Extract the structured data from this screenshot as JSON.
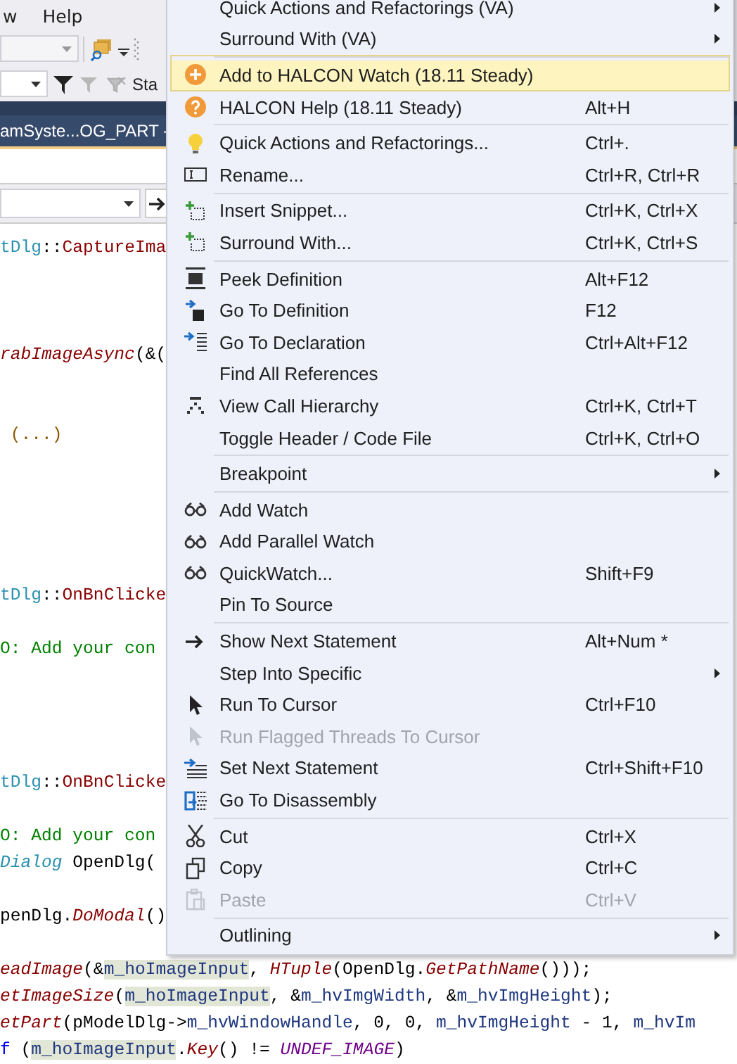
{
  "menu_bar": {
    "items": [
      "w",
      "Help"
    ]
  },
  "toolbar": {
    "overflow_label": "Sta"
  },
  "document_tab": {
    "title": "amSyste...OG_PART -"
  },
  "code_lines": [
    {
      "kind": "code",
      "segments": [
        {
          "t": "tDlg",
          "kind": "class"
        },
        {
          "t": "::",
          "kind": "plain"
        },
        {
          "t": "CaptureIma",
          "kind": "method"
        }
      ]
    },
    {
      "kind": "blank"
    },
    {
      "kind": "blank"
    },
    {
      "kind": "blank"
    },
    {
      "kind": "code",
      "segments": [
        {
          "t": "rabImageAsync",
          "kind": "func"
        },
        {
          "t": "(&(",
          "kind": "plain"
        }
      ]
    },
    {
      "kind": "blank"
    },
    {
      "kind": "blank"
    },
    {
      "kind": "code",
      "segments": [
        {
          "t": " (...)",
          "kind": "collapsed"
        }
      ]
    },
    {
      "kind": "blank"
    },
    {
      "kind": "blank"
    },
    {
      "kind": "blank"
    },
    {
      "kind": "blank"
    },
    {
      "kind": "blank"
    },
    {
      "kind": "code",
      "segments": [
        {
          "t": "tDlg",
          "kind": "class"
        },
        {
          "t": "::",
          "kind": "plain"
        },
        {
          "t": "OnBnClicke",
          "kind": "method"
        }
      ]
    },
    {
      "kind": "blank"
    },
    {
      "kind": "code",
      "segments": [
        {
          "t": "O: Add your con",
          "kind": "comment"
        }
      ]
    },
    {
      "kind": "blank"
    },
    {
      "kind": "blank"
    },
    {
      "kind": "blank"
    },
    {
      "kind": "blank"
    },
    {
      "kind": "code",
      "segments": [
        {
          "t": "tDlg",
          "kind": "class"
        },
        {
          "t": "::",
          "kind": "plain"
        },
        {
          "t": "OnBnClicke",
          "kind": "method"
        }
      ]
    },
    {
      "kind": "blank"
    },
    {
      "kind": "code",
      "segments": [
        {
          "t": "O: Add your con",
          "kind": "comment"
        }
      ]
    },
    {
      "kind": "code",
      "segments": [
        {
          "t": "Dialog",
          "kind": "class-italic"
        },
        {
          "t": " OpenDlg(",
          "kind": "plain"
        }
      ]
    },
    {
      "kind": "blank"
    },
    {
      "kind": "code",
      "segments": [
        {
          "t": "penDlg.",
          "kind": "plain"
        },
        {
          "t": "DoModal",
          "kind": "func"
        },
        {
          "t": "()",
          "kind": "plain"
        }
      ]
    },
    {
      "kind": "blank"
    },
    {
      "kind": "code",
      "segments": [
        {
          "t": "eadImage",
          "kind": "func"
        },
        {
          "t": "(&",
          "kind": "plain"
        },
        {
          "t": "m_hoImageInput",
          "kind": "var-hl"
        },
        {
          "t": ", ",
          "kind": "plain"
        },
        {
          "t": "HTuple",
          "kind": "func"
        },
        {
          "t": "(OpenDlg.",
          "kind": "plain"
        },
        {
          "t": "GetPathName",
          "kind": "func"
        },
        {
          "t": "()));",
          "kind": "plain"
        }
      ]
    },
    {
      "kind": "code",
      "segments": [
        {
          "t": "etImageSize",
          "kind": "func"
        },
        {
          "t": "(",
          "kind": "plain"
        },
        {
          "t": "m_hoImageInput",
          "kind": "var-hl"
        },
        {
          "t": ", &",
          "kind": "plain"
        },
        {
          "t": "m_hvImgWidth",
          "kind": "var"
        },
        {
          "t": ", &",
          "kind": "plain"
        },
        {
          "t": "m_hvImgHeight",
          "kind": "var"
        },
        {
          "t": ");",
          "kind": "plain"
        }
      ]
    },
    {
      "kind": "code",
      "segments": [
        {
          "t": "etPart",
          "kind": "func"
        },
        {
          "t": "(pModelDlg->",
          "kind": "plain"
        },
        {
          "t": "m_hvWindowHandle",
          "kind": "var"
        },
        {
          "t": ", 0, 0, ",
          "kind": "plain"
        },
        {
          "t": "m_hvImgHeight",
          "kind": "var"
        },
        {
          "t": " - 1, ",
          "kind": "plain"
        },
        {
          "t": "m_hvIm",
          "kind": "var"
        }
      ]
    },
    {
      "kind": "code",
      "segments": [
        {
          "t": "f",
          "kind": "keyword"
        },
        {
          "t": " (",
          "kind": "plain"
        },
        {
          "t": "m_hoImageInput",
          "kind": "var-hl"
        },
        {
          "t": ".",
          "kind": "plain"
        },
        {
          "t": "Key",
          "kind": "func"
        },
        {
          "t": "() != ",
          "kind": "plain"
        },
        {
          "t": "UNDEF_IMAGE",
          "kind": "macro"
        },
        {
          "t": ")",
          "kind": "plain"
        }
      ]
    }
  ],
  "context_menu": {
    "items": [
      {
        "label": "Quick Actions and Refactorings (VA)",
        "kind": "none",
        "submenu": true,
        "disabled": false,
        "selected": false,
        "separator_before": false
      },
      {
        "label": "Surround With (VA)",
        "kind": "none",
        "submenu": true,
        "disabled": false,
        "selected": false,
        "separator_before": false
      },
      {
        "label": "Add to HALCON Watch (18.11 Steady)",
        "kind": "plus-circle",
        "submenu": false,
        "disabled": false,
        "selected": true,
        "separator_before": true
      },
      {
        "label": "HALCON Help (18.11 Steady)",
        "shortcut": "Alt+H",
        "kind": "help-circle",
        "submenu": false,
        "disabled": false,
        "selected": false,
        "separator_before": false
      },
      {
        "label": "Quick Actions and Refactorings...",
        "shortcut": "Ctrl+.",
        "kind": "lightbulb",
        "submenu": false,
        "disabled": false,
        "selected": false,
        "separator_before": true
      },
      {
        "label": "Rename...",
        "shortcut": "Ctrl+R, Ctrl+R",
        "kind": "rename",
        "submenu": false,
        "disabled": false,
        "selected": false,
        "separator_before": false
      },
      {
        "label": "Insert Snippet...",
        "shortcut": "Ctrl+K, Ctrl+X",
        "kind": "snippet",
        "submenu": false,
        "disabled": false,
        "selected": false,
        "separator_before": true
      },
      {
        "label": "Surround With...",
        "shortcut": "Ctrl+K, Ctrl+S",
        "kind": "snippet",
        "submenu": false,
        "disabled": false,
        "selected": false,
        "separator_before": false
      },
      {
        "label": "Peek Definition",
        "shortcut": "Alt+F12",
        "kind": "peek",
        "submenu": false,
        "disabled": false,
        "selected": false,
        "separator_before": true
      },
      {
        "label": "Go To Definition",
        "shortcut": "F12",
        "kind": "goto-def",
        "submenu": false,
        "disabled": false,
        "selected": false,
        "separator_before": false
      },
      {
        "label": "Go To Declaration",
        "shortcut": "Ctrl+Alt+F12",
        "kind": "goto-decl",
        "submenu": false,
        "disabled": false,
        "selected": false,
        "separator_before": false
      },
      {
        "label": "Find All References",
        "kind": "none",
        "submenu": false,
        "disabled": false,
        "selected": false,
        "separator_before": false
      },
      {
        "label": "View Call Hierarchy",
        "shortcut": "Ctrl+K, Ctrl+T",
        "kind": "hierarchy",
        "submenu": false,
        "disabled": false,
        "selected": false,
        "separator_before": false
      },
      {
        "label": "Toggle Header / Code File",
        "shortcut": "Ctrl+K, Ctrl+O",
        "kind": "none",
        "submenu": false,
        "disabled": false,
        "selected": false,
        "separator_before": false
      },
      {
        "label": "Breakpoint",
        "kind": "none",
        "submenu": true,
        "disabled": false,
        "selected": false,
        "separator_before": true
      },
      {
        "label": "Add Watch",
        "kind": "glasses",
        "submenu": false,
        "disabled": false,
        "selected": false,
        "separator_before": true
      },
      {
        "label": "Add Parallel Watch",
        "kind": "glasses",
        "submenu": false,
        "disabled": false,
        "selected": false,
        "separator_before": false
      },
      {
        "label": "QuickWatch...",
        "shortcut": "Shift+F9",
        "kind": "glasses",
        "submenu": false,
        "disabled": false,
        "selected": false,
        "separator_before": false
      },
      {
        "label": "Pin To Source",
        "kind": "none",
        "submenu": false,
        "disabled": false,
        "selected": false,
        "separator_before": false
      },
      {
        "label": "Show Next Statement",
        "shortcut": "Alt+Num *",
        "kind": "arrow",
        "submenu": false,
        "disabled": false,
        "selected": false,
        "separator_before": true
      },
      {
        "label": "Step Into Specific",
        "kind": "none",
        "submenu": true,
        "disabled": false,
        "selected": false,
        "separator_before": false
      },
      {
        "label": "Run To Cursor",
        "shortcut": "Ctrl+F10",
        "kind": "pointer",
        "submenu": false,
        "disabled": false,
        "selected": false,
        "separator_before": false
      },
      {
        "label": "Run Flagged Threads To Cursor",
        "kind": "pointer",
        "submenu": false,
        "disabled": true,
        "selected": false,
        "separator_before": false
      },
      {
        "label": "Set Next Statement",
        "shortcut": "Ctrl+Shift+F10",
        "kind": "set-next",
        "submenu": false,
        "disabled": false,
        "selected": false,
        "separator_before": false
      },
      {
        "label": "Go To Disassembly",
        "kind": "disassembly",
        "submenu": false,
        "disabled": false,
        "selected": false,
        "separator_before": false
      },
      {
        "label": "Cut",
        "shortcut": "Ctrl+X",
        "kind": "scissors",
        "submenu": false,
        "disabled": false,
        "selected": false,
        "separator_before": true
      },
      {
        "label": "Copy",
        "shortcut": "Ctrl+C",
        "kind": "copy",
        "submenu": false,
        "disabled": false,
        "selected": false,
        "separator_before": false
      },
      {
        "label": "Paste",
        "shortcut": "Ctrl+V",
        "kind": "paste",
        "submenu": false,
        "disabled": true,
        "selected": false,
        "separator_before": false
      },
      {
        "label": "Outlining",
        "kind": "none",
        "submenu": true,
        "disabled": false,
        "selected": false,
        "separator_before": true
      }
    ]
  }
}
